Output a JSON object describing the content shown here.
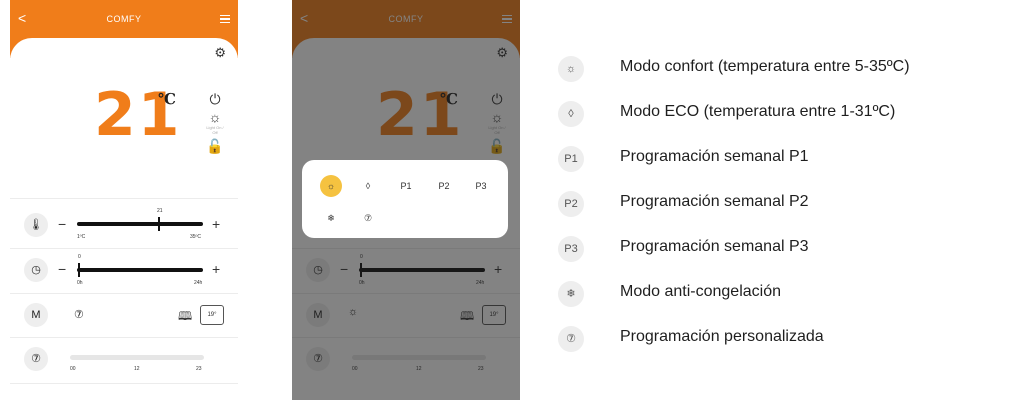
{
  "app": {
    "title": "COMFY",
    "back_icon": "chevron-left-icon",
    "menu_icon": "hamburger-icon"
  },
  "thermostat": {
    "temperature": "21",
    "unit": "℃",
    "light_label": "Light\nOn / Off"
  },
  "temp_slider": {
    "current_label": "21",
    "min_label": "1ºC",
    "max_label": "35ºC",
    "minus": "−",
    "plus": "+"
  },
  "timer_slider": {
    "current_label": "0",
    "min_label": "0h",
    "max_label": "24h",
    "minus": "−",
    "plus": "+"
  },
  "mode_row": {
    "mode_button": "M",
    "program_icon": "⑦",
    "house_label": "19°"
  },
  "schedule": {
    "ticks": [
      "00",
      "12",
      "23"
    ],
    "program_icon": "⑦"
  },
  "popup": {
    "buttons": [
      {
        "label": "☼",
        "icon": "sun-icon",
        "active": true
      },
      {
        "label": "◊",
        "icon": "leaf-icon",
        "active": false
      },
      {
        "label": "P1",
        "icon": "",
        "active": false
      },
      {
        "label": "P2",
        "icon": "",
        "active": false
      },
      {
        "label": "P3",
        "icon": "",
        "active": false
      },
      {
        "label": "❄",
        "icon": "snowflake-icon",
        "active": false
      },
      {
        "label": "⑦",
        "icon": "custom-program-icon",
        "active": false
      }
    ]
  },
  "legend": [
    {
      "icon": "☼",
      "text": "Modo confort (temperatura entre 5-35ºC)"
    },
    {
      "icon": "◊",
      "text": "Modo ECO (temperatura entre 1-31ºC)"
    },
    {
      "icon": "P1",
      "text": "Programación semanal P1"
    },
    {
      "icon": "P2",
      "text": "Programación semanal P2"
    },
    {
      "icon": "P3",
      "text": "Programación semanal P3"
    },
    {
      "icon": "❄",
      "text": "Modo anti-congelación"
    },
    {
      "icon": "⑦",
      "text": "Programación personalizada"
    }
  ],
  "colors": {
    "accent": "#f07d1a",
    "active_mode": "#f5c240"
  }
}
